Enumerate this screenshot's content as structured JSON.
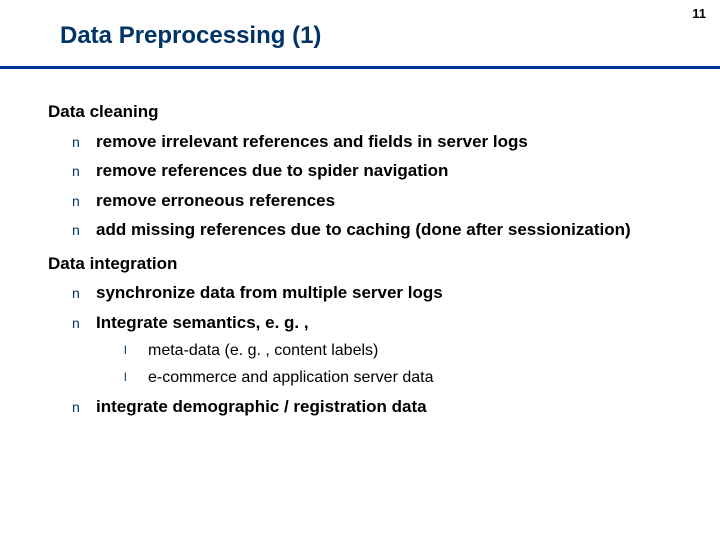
{
  "page_number": "11",
  "title": "Data Preprocessing (1)",
  "bullets": {
    "n": "n",
    "l": "l"
  },
  "sections": [
    {
      "heading": "Data cleaning",
      "items": [
        {
          "text": "remove irrelevant references and fields in server logs"
        },
        {
          "text": "remove references due to spider navigation"
        },
        {
          "text": "remove erroneous references"
        },
        {
          "text": "add missing references due to caching (done after sessionization)"
        }
      ]
    },
    {
      "heading": "Data integration",
      "items": [
        {
          "text": "synchronize data from multiple server logs"
        },
        {
          "text": "Integrate semantics, e. g. ,",
          "sub": [
            {
              "text": "meta-data (e. g. , content labels)"
            },
            {
              "text": "e-commerce and application server data"
            }
          ]
        },
        {
          "text": "integrate demographic / registration data"
        }
      ]
    }
  ]
}
